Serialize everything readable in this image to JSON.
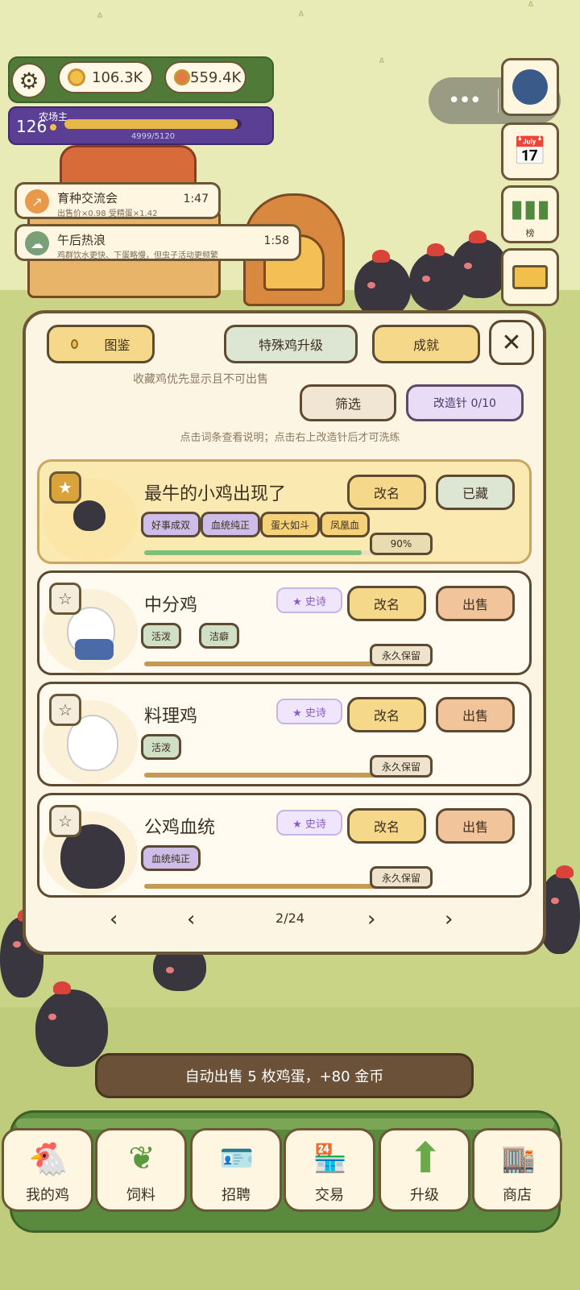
{
  "hud": {
    "coins": "106.3K",
    "eggs": "559.4K",
    "level": "126",
    "level_title": "农场主",
    "xp": "4999/5120",
    "xp_progress": 0.976
  },
  "side": {
    "rank_label": "榜"
  },
  "events": [
    {
      "title": "育种交流会",
      "desc": "出售价×0.98 受精蛋×1.42",
      "time": "1:47"
    },
    {
      "title": "午后热浪",
      "desc": "鸡群饮水更快、下蛋略慢，但虫子活动更频繁",
      "time": "1:58"
    }
  ],
  "panel": {
    "tab_guide": "图鉴",
    "tab_special": "特殊鸡升级",
    "tab_achieve": "成就",
    "hint_collect": "收藏鸡优先显示且不可出售",
    "filter": "筛选",
    "needle": "改造针 0/10",
    "hint_click": "点击词条查看说明；点击右上改造针后才可洗练"
  },
  "cards": [
    {
      "name": "最牛的小鸡出现了",
      "rename": "改名",
      "action": "已藏",
      "tags": [
        "好事成双",
        "血统纯正",
        "蛋大如斗",
        "凤凰血"
      ],
      "progress_label": "90%",
      "progress": 0.9,
      "favorite": true
    },
    {
      "name": "中分鸡",
      "epic": "★ 史诗",
      "rename": "改名",
      "action": "出售",
      "tags": [
        "活泼",
        "洁癖"
      ],
      "keep": "永久保留"
    },
    {
      "name": "料理鸡",
      "epic": "★ 史诗",
      "rename": "改名",
      "action": "出售",
      "tags": [
        "活泼"
      ],
      "keep": "永久保留"
    },
    {
      "name": "公鸡血统",
      "epic": "★ 史诗",
      "rename": "改名",
      "action": "出售",
      "tags": [
        "血统纯正"
      ],
      "keep": "永久保留"
    }
  ],
  "pager": {
    "first": "‹",
    "prev": "‹",
    "page": "2/24",
    "next": "›",
    "last": "›"
  },
  "toast": "自动出售 5 枚鸡蛋，+80 金币",
  "nav": [
    "我的鸡",
    "饲料",
    "招聘",
    "交易",
    "升级",
    "商店"
  ]
}
